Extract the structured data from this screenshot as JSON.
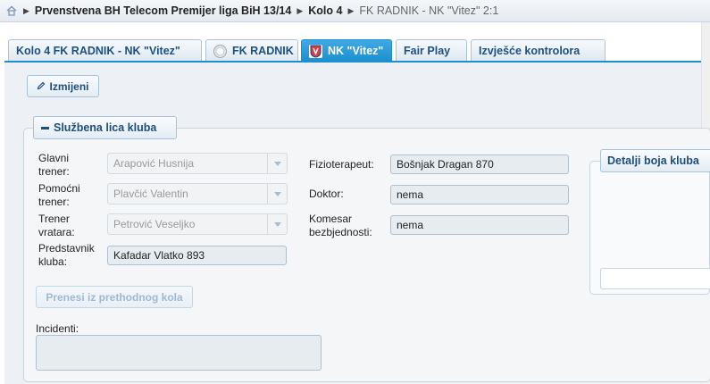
{
  "breadcrumb": {
    "items": [
      "Prvenstvena BH Telecom Premijer liga BiH 13/14",
      "Kolo 4",
      "FK RADNIK - NK \"Vitez\" 2:1"
    ]
  },
  "tabs": [
    {
      "label": "Kolo 4 FK RADNIK - NK \"Vitez\"",
      "active": false,
      "icon": ""
    },
    {
      "label": "FK RADNIK",
      "active": false,
      "icon": "fk-radnik-logo"
    },
    {
      "label": "NK \"Vitez\"",
      "active": true,
      "icon": "nk-vitez-logo"
    },
    {
      "label": "Fair Play",
      "active": false,
      "icon": ""
    },
    {
      "label": "Izvješće kontrolora",
      "active": false,
      "icon": ""
    }
  ],
  "toolbar": {
    "edit_label": "Izmijeni",
    "edit_icon": "pencil-icon"
  },
  "officials": {
    "legend": "Službena lica kluba",
    "head_coach": {
      "label_line1": "Glavni",
      "label_line2": "trener:",
      "value": "Arapović Husnija"
    },
    "assistant_coach": {
      "label_line1": "Pomoćni",
      "label_line2": "trener:",
      "value": "Plavčić Valentin"
    },
    "goalkeeper_coach": {
      "label_line1": "Trener",
      "label_line2": "vratara:",
      "value": "Petrović Veseljko"
    },
    "club_rep": {
      "label_line1": "Predstavnik",
      "label_line2": "kluba:",
      "value": "Kafadar Vlatko 893"
    },
    "physio": {
      "label": "Fizioterapeut:",
      "value": "Bošnjak Dragan 870"
    },
    "doctor": {
      "label": "Doktor:",
      "value": "nema"
    },
    "security": {
      "label_line1": "Komesar",
      "label_line2": "bezbjednosti:",
      "value": "nema"
    },
    "copy_button": "Prenesi iz prethodnog kola",
    "incidents_label": "Incidenti:",
    "incidents_value": ""
  },
  "colors_panel": {
    "legend": "Detalji boja kluba"
  },
  "colors": {
    "accent": "#1b8fd0",
    "header_text": "#1d5080"
  }
}
